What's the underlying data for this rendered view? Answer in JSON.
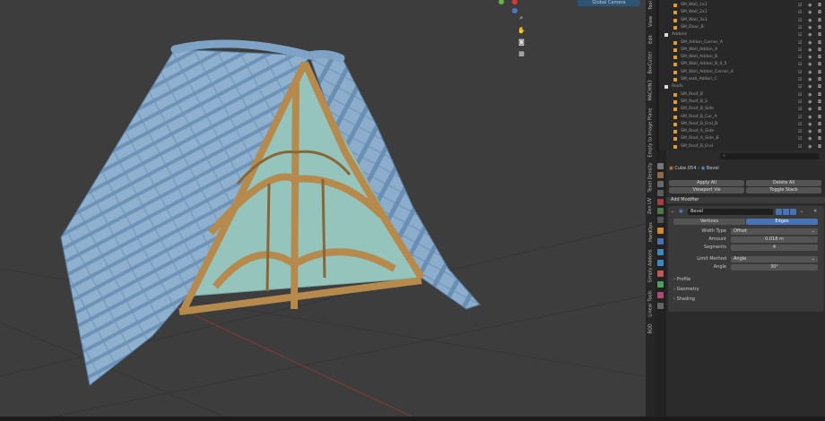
{
  "viewport": {
    "header_button": "Global Camera",
    "nav_icons": [
      "zoom-icon",
      "hand-pan-icon",
      "camera-icon",
      "grid-icon"
    ]
  },
  "npanel_tabs": [
    "Tool",
    "View",
    "Edit",
    "BoxCutter",
    "MACHIN3",
    "Empty to Image Plane",
    "Texel Density",
    "Zen UV",
    "HardOps",
    "Simply Addons",
    "Linear Tools",
    "BQD"
  ],
  "outliner": {
    "rows": [
      {
        "label": "SM_Wall_1x1",
        "indent": 2,
        "kind": "mesh"
      },
      {
        "label": "SM_Wall_2x1",
        "indent": 2,
        "kind": "mesh"
      },
      {
        "label": "SM_Wall_3x1",
        "indent": 2,
        "kind": "mesh"
      },
      {
        "label": "SM_Door_B",
        "indent": 2,
        "kind": "mesh"
      },
      {
        "label": "Addons",
        "indent": 1,
        "kind": "collection"
      },
      {
        "label": "SM_Addon_Corner_A",
        "indent": 2,
        "kind": "mesh"
      },
      {
        "label": "SM_Wall_Addon_A",
        "indent": 2,
        "kind": "mesh"
      },
      {
        "label": "SM_Wall_Addon_B",
        "indent": 2,
        "kind": "mesh"
      },
      {
        "label": "SM_Wall_Addon_B_0_5",
        "indent": 2,
        "kind": "mesh"
      },
      {
        "label": "SM_Wall_Addon_Corner_A",
        "indent": 2,
        "kind": "mesh"
      },
      {
        "label": "SM_wall_Addon_C",
        "indent": 2,
        "kind": "mesh"
      },
      {
        "label": "Roofs",
        "indent": 1,
        "kind": "collection"
      },
      {
        "label": "SM_Roof_B",
        "indent": 2,
        "kind": "mesh"
      },
      {
        "label": "SM_Roof_B_S",
        "indent": 2,
        "kind": "mesh"
      },
      {
        "label": "SM_Roof_B_Side",
        "indent": 2,
        "kind": "mesh"
      },
      {
        "label": "SM_Roof_B_Cur_A",
        "indent": 2,
        "kind": "mesh"
      },
      {
        "label": "SM_Roof_B_End_B",
        "indent": 2,
        "kind": "mesh"
      },
      {
        "label": "SM_Roof_A_Side",
        "indent": 2,
        "kind": "mesh"
      },
      {
        "label": "SM_Roof_A_Side_B",
        "indent": 2,
        "kind": "mesh"
      },
      {
        "label": "SM_Roof_B_End",
        "indent": 2,
        "kind": "mesh"
      }
    ]
  },
  "properties": {
    "search_placeholder": "",
    "breadcrumb_object": "Cube.054",
    "breadcrumb_modifier": "Bevel",
    "apply_all": "Apply All",
    "delete_all": "Delete All",
    "viewport_vis": "Viewport Vis",
    "toggle_stack": "Toggle Stack",
    "add_modifier": "Add Modifier",
    "modifier_name": "Bevel",
    "tab_vertices": "Vertices",
    "tab_edges": "Edges",
    "width_type_label": "Width Type",
    "width_type_value": "Offset",
    "amount_label": "Amount",
    "amount_value": "0.018 m",
    "segments_label": "Segments",
    "segments_value": "4",
    "limit_method_label": "Limit Method",
    "limit_method_value": "Angle",
    "angle_label": "Angle",
    "angle_value": "30°",
    "section_profile": "Profile",
    "section_geometry": "Geometry",
    "section_shading": "Shading"
  },
  "colors": {
    "accent": "#4772b3",
    "roof_tile": "#86a9c9",
    "wood": "#b0874b",
    "glass": "#8fbfb8",
    "viewport_bg": "#3d3d3d"
  }
}
